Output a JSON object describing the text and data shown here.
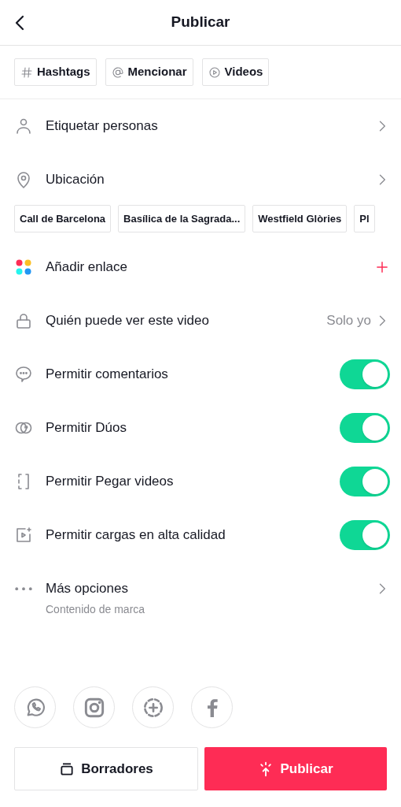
{
  "header": {
    "title": "Publicar"
  },
  "chips": [
    {
      "label": "Hashtags"
    },
    {
      "label": "Mencionar"
    },
    {
      "label": "Videos"
    }
  ],
  "settings": [
    {
      "kind": "link",
      "label": "Etiquetar personas"
    },
    {
      "kind": "link",
      "label": "Ubicación",
      "suggestions": [
        "Call de Barcelona",
        "Basílica de la Sagrada...",
        "Westfield Glòries",
        "Pl"
      ]
    },
    {
      "kind": "add",
      "label": "Añadir enlace"
    },
    {
      "kind": "value",
      "label": "Quién puede ver este video",
      "value": "Solo yo"
    },
    {
      "kind": "toggle",
      "label": "Permitir comentarios",
      "on": true
    },
    {
      "kind": "toggle",
      "label": "Permitir Dúos",
      "on": true
    },
    {
      "kind": "toggle",
      "label": "Permitir Pegar videos",
      "on": true
    },
    {
      "kind": "toggle",
      "label": "Permitir cargas en alta calidad",
      "on": true
    },
    {
      "kind": "link",
      "label": "Más opciones",
      "subtitle": "Contenido de marca"
    }
  ],
  "footer": {
    "drafts": "Borradores",
    "publish": "Publicar"
  }
}
